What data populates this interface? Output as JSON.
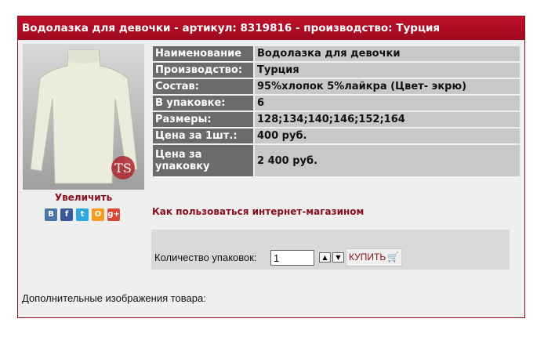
{
  "product": {
    "header": "Водолазка для девочки - артикул: 8319816 - производство: Турция",
    "enlarge_label": "Увеличить",
    "how_to_link": "Как пользоваться интернет-магазином",
    "extra_images_label": "Дополнительные изображения товара:",
    "logo_text": "TS"
  },
  "specs": [
    {
      "key": "Наименование",
      "value": "Водолазка для девочки"
    },
    {
      "key": "Производство:",
      "value": "Турция"
    },
    {
      "key": "Состав:",
      "value": "95%хлопок 5%лайкра (Цвет- экрю)"
    },
    {
      "key": "В упаковке:",
      "value": "6"
    },
    {
      "key": "Размеры:",
      "value": "128;134;140;146;152;164"
    },
    {
      "key": "Цена за 1шт.:",
      "value": "400 руб."
    },
    {
      "key": "Цена за упаковку",
      "value": "2 400 руб."
    }
  ],
  "social": [
    {
      "name": "vk-icon",
      "glyph": "В",
      "color": "#4a76a8"
    },
    {
      "name": "facebook-icon",
      "glyph": "f",
      "color": "#3b5998"
    },
    {
      "name": "twitter-icon",
      "glyph": "t",
      "color": "#2fa9e0"
    },
    {
      "name": "odnoklassniki-icon",
      "glyph": "О",
      "color": "#f59a23"
    },
    {
      "name": "google-plus-icon",
      "glyph": "g+",
      "color": "#d34836"
    }
  ],
  "order": {
    "qty_label": "Количество упаковок:",
    "qty_value": "1",
    "buy_label": "КУПИТЬ",
    "up_icon": "arrow-up-icon",
    "down_icon": "arrow-down-icon",
    "cart_icon": "cart-icon"
  }
}
